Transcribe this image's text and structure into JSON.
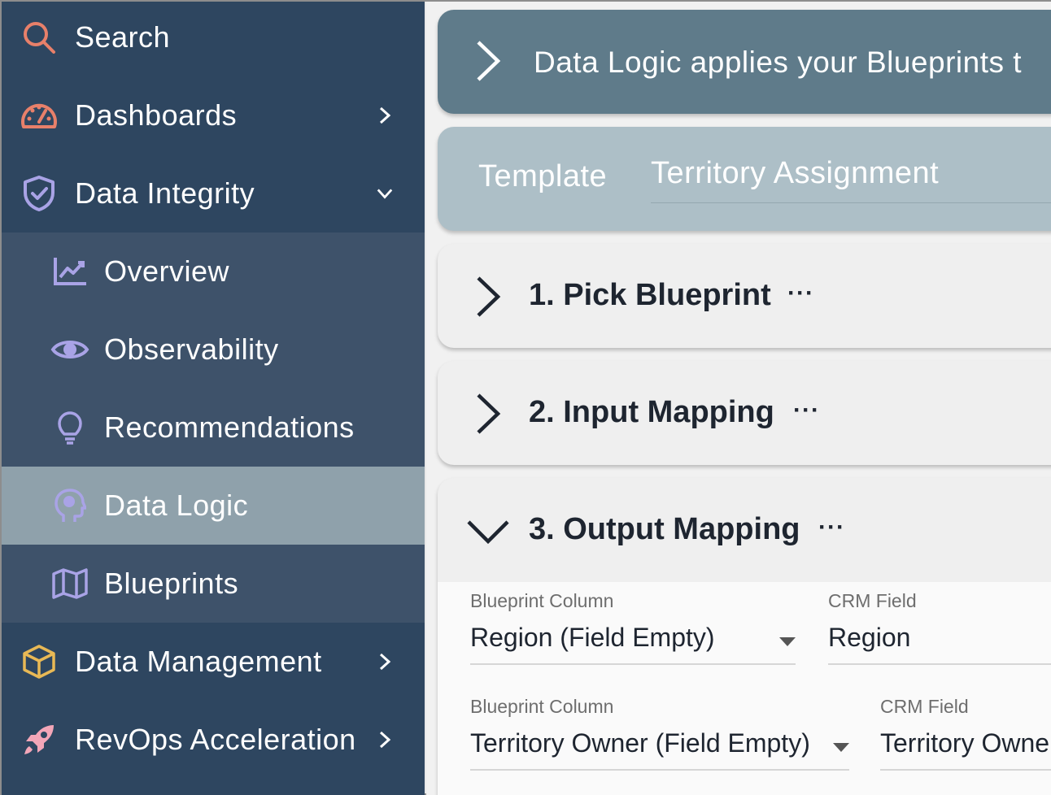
{
  "sidebar": {
    "items": [
      {
        "label": "Search",
        "icon": "search-icon"
      },
      {
        "label": "Dashboards",
        "icon": "speedometer-icon"
      },
      {
        "label": "Data Integrity",
        "icon": "shield-check-icon"
      },
      {
        "label": "Data Management",
        "icon": "cube-icon"
      },
      {
        "label": "RevOps Acceleration",
        "icon": "rocket-icon"
      }
    ],
    "sub_items": [
      {
        "label": "Overview",
        "icon": "chart-line-icon"
      },
      {
        "label": "Observability",
        "icon": "eye-icon"
      },
      {
        "label": "Recommendations",
        "icon": "lightbulb-icon"
      },
      {
        "label": "Data Logic",
        "icon": "brain-head-icon",
        "active": true
      },
      {
        "label": "Blueprints",
        "icon": "map-icon"
      }
    ]
  },
  "main": {
    "banner_text": "Data Logic applies your Blueprints t",
    "template": {
      "label": "Template",
      "value": "Territory Assignment"
    },
    "steps": [
      {
        "title": "1. Pick Blueprint",
        "more": "···"
      },
      {
        "title": "2. Input Mapping",
        "more": "···"
      },
      {
        "title": "3. Output Mapping",
        "more": "···"
      }
    ],
    "mappings": [
      {
        "col_label": "Blueprint Column",
        "col_value": "Region (Field Empty)",
        "crm_label": "CRM Field",
        "crm_value": "Region"
      },
      {
        "col_label": "Blueprint Column",
        "col_value": "Territory Owner (Field Empty)",
        "crm_label": "CRM Field",
        "crm_value": "Territory Owne"
      }
    ]
  },
  "colors": {
    "sidebar_bg": "#2e4660",
    "sub_bg": "#3e526a",
    "active_bg": "#8fa1ab",
    "banner_bg": "#5f7b8a",
    "template_bg": "#adbfc7",
    "accent_orange": "#e8806a",
    "accent_purple": "#a9a3e6"
  }
}
